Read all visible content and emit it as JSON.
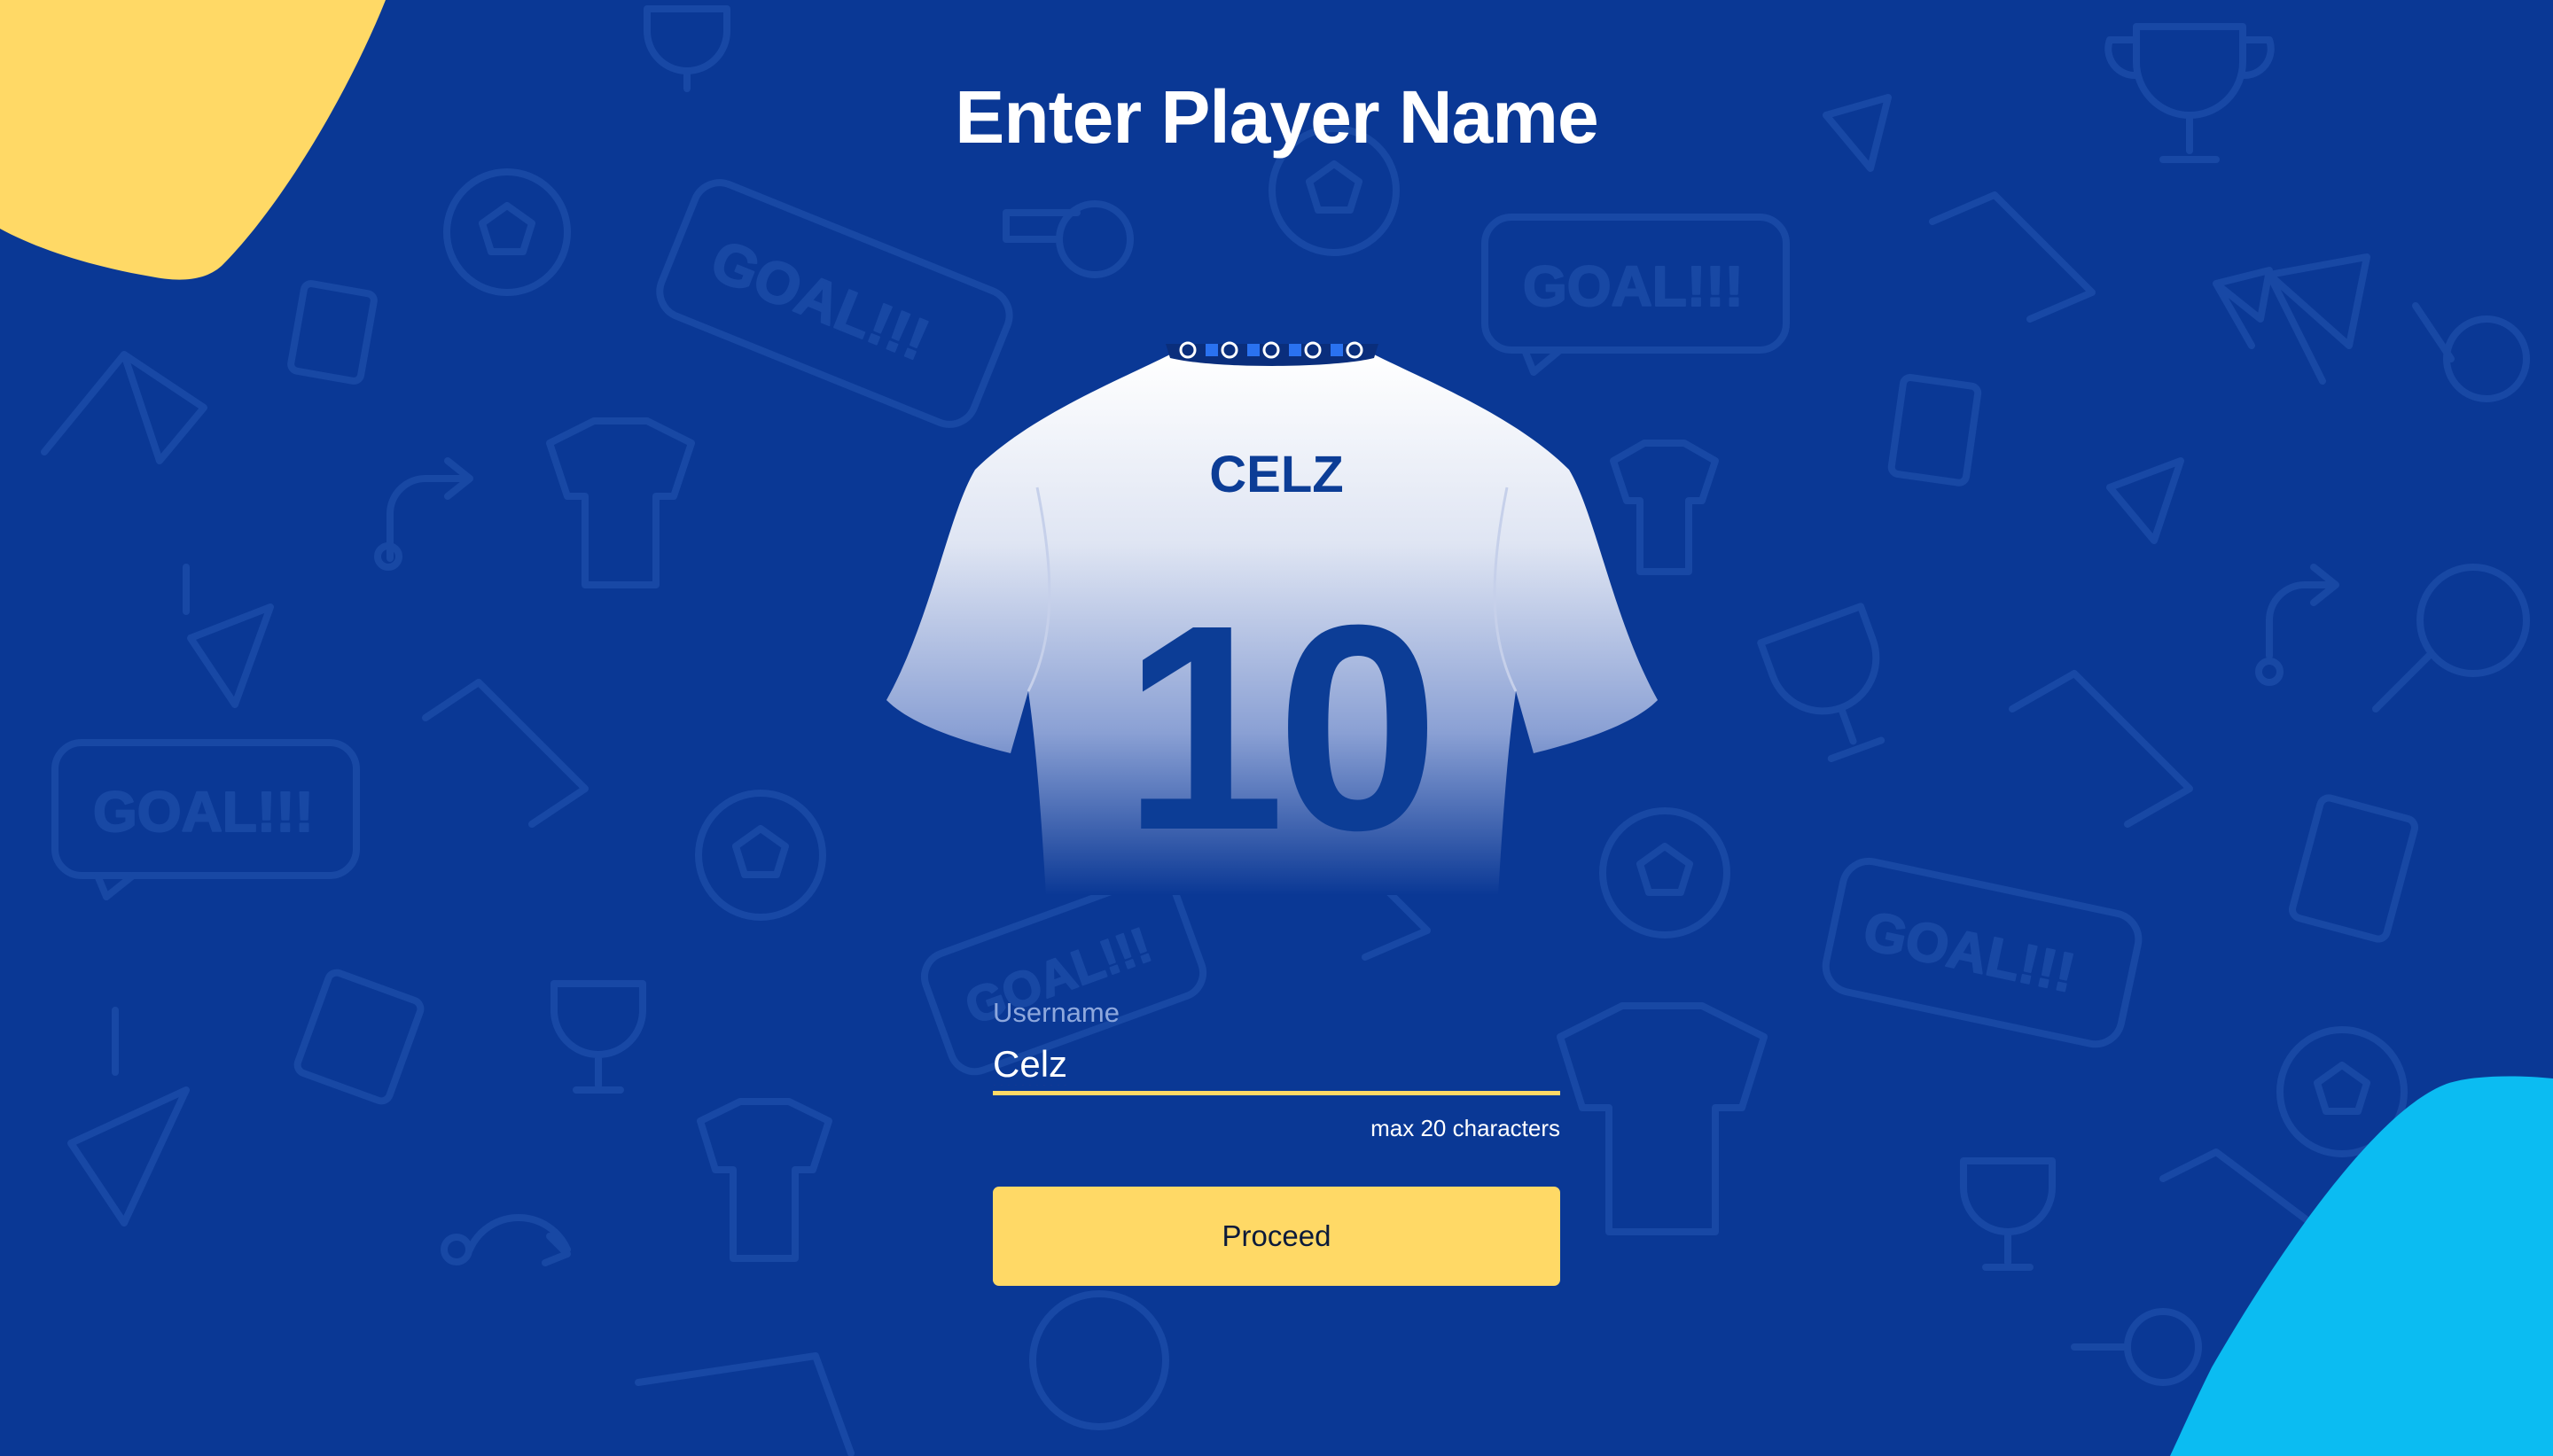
{
  "page": {
    "title": "Enter Player Name"
  },
  "jersey": {
    "name": "CELZ",
    "number": "10"
  },
  "form": {
    "username_label": "Username",
    "username_value": "Celz",
    "hint": "max 20 characters",
    "proceed_label": "Proceed"
  },
  "background": {
    "speech_bubble_text": "GOAL!!!"
  },
  "colors": {
    "background": "#0a3895",
    "accent_yellow": "#ffd966",
    "accent_cyan": "#0bbcf2",
    "jersey_text": "#0c3d96",
    "input_underline": "#ffd966"
  }
}
